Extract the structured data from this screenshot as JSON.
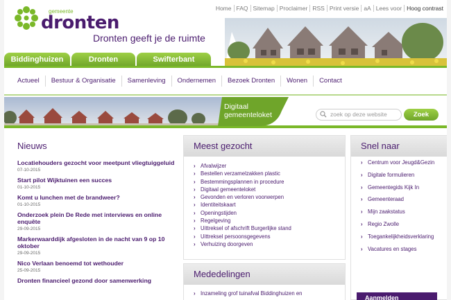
{
  "logo": {
    "pre": "gemeente",
    "name": "dronten"
  },
  "tagline": "Dronten geeft je de ruimte",
  "toplinks": [
    "Home",
    "FAQ",
    "Sitemap",
    "Proclaimer",
    "RSS",
    "Print versie",
    "aA",
    "Lees voor",
    "Hoog contrast"
  ],
  "tabs": [
    "Biddinghuizen",
    "Dronten",
    "Swifterbant"
  ],
  "nav": [
    "Actueel",
    "Bestuur & Organisatie",
    "Samenleving",
    "Ondernemen",
    "Bezoek Dronten",
    "Wonen",
    "Contact"
  ],
  "loket": {
    "line1": "Digitaal",
    "line2": "gemeenteloket"
  },
  "search": {
    "placeholder": "zoek op deze website",
    "button": "Zoek"
  },
  "nieuws": {
    "title": "Nieuws",
    "items": [
      {
        "title": "Locatiehouders gezocht voor meetpunt vliegtuiggeluid",
        "date": "07-10-2015"
      },
      {
        "title": "Start pilot Wijktuinen een succes",
        "date": "01-10-2015"
      },
      {
        "title": "Komt u lunchen met de brandweer?",
        "date": "01-10-2015"
      },
      {
        "title": "Onderzoek plein De Rede met interviews en online enquête",
        "date": "29-09-2015"
      },
      {
        "title": "Markerwaarddijk afgesloten in de nacht van 9 op 10 oktober",
        "date": "29-09-2015"
      },
      {
        "title": "Nico Verlaan benoemd tot wethouder",
        "date": "25-09-2015"
      },
      {
        "title": "Dronten financieel gezond door samenwerking",
        "date": ""
      }
    ]
  },
  "meest": {
    "title": "Meest gezocht",
    "items": [
      "Afvalwijzer",
      "Bestellen verzamelzakken plastic",
      "Bestemmingsplannen in procedure",
      "Digitaal gemeenteloket",
      "Gevonden en verloren voorwerpen",
      "Identiteitskaart",
      "Openingstijden",
      "Regelgeving",
      "Uittreksel of afschrift Burgerlijke stand",
      "Uittreksel persoonsgegevens",
      "Verhuizing doorgeven"
    ]
  },
  "mededelingen": {
    "title": "Mededelingen",
    "first": "Inzameling grof tuinafval Biddinghuizen en"
  },
  "snel": {
    "title": "Snel naar",
    "items": [
      "Centrum voor Jeugd&Gezin",
      "Digitale formulieren",
      "Gemeentegids Kijk In",
      "Gemeenteraad",
      "Mijn zaakstatus",
      "Regio Zwolle",
      "Toegankelijkheidsverklaring",
      "Vacatures en stages"
    ],
    "button": "Aanmelden"
  },
  "colors": {
    "purple": "#4a1b6e",
    "green": "#7ab829"
  }
}
